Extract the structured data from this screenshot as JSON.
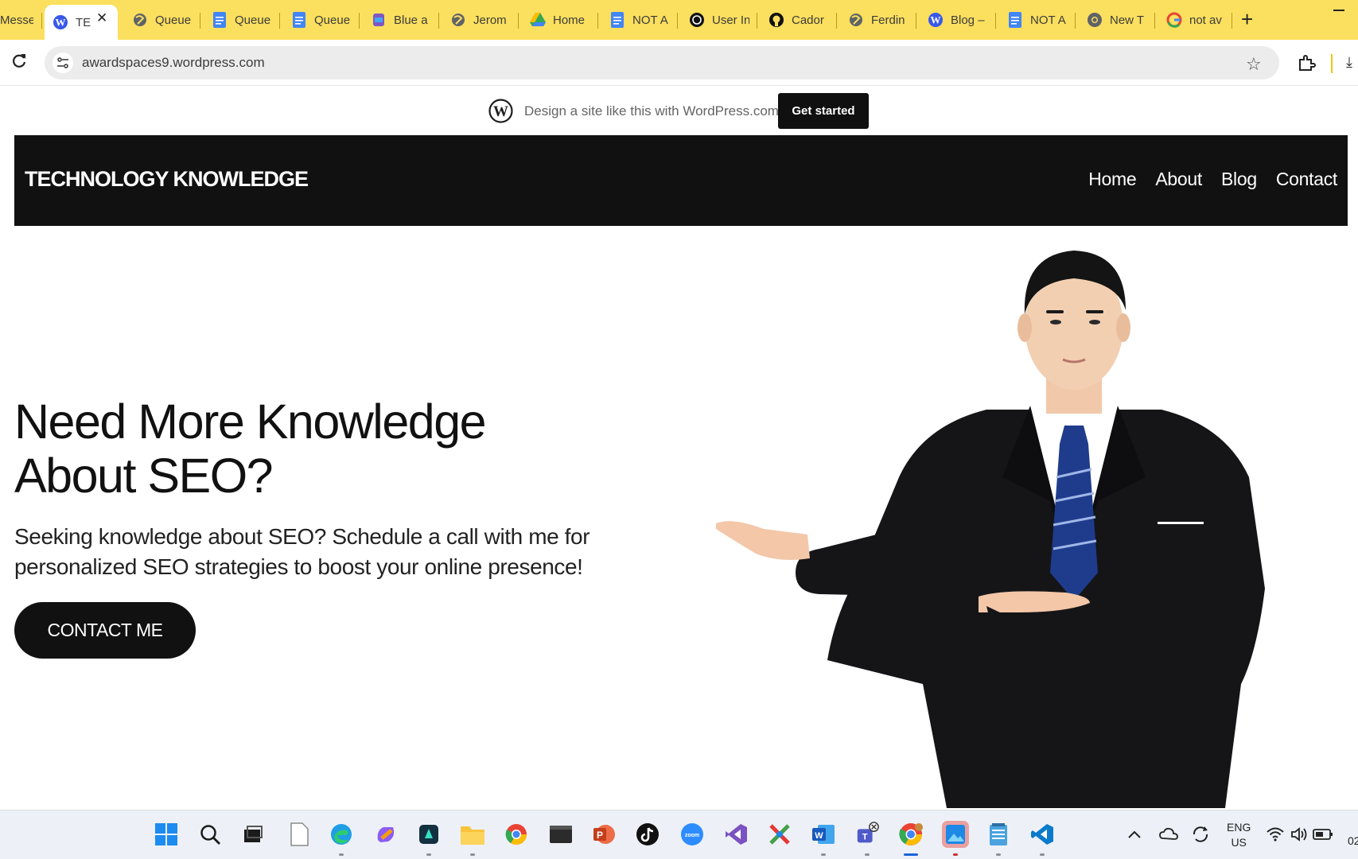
{
  "browser": {
    "tabs": [
      {
        "label": "Messe",
        "icon": "messenger-icon"
      },
      {
        "label": "TE",
        "icon": "wordpress-icon",
        "active": true
      },
      {
        "label": "Queue",
        "icon": "globe-icon"
      },
      {
        "label": "Queue",
        "icon": "docs-icon"
      },
      {
        "label": "Queue",
        "icon": "docs-icon"
      },
      {
        "label": "Blue a",
        "icon": "print-icon"
      },
      {
        "label": "Jerom",
        "icon": "globe-icon"
      },
      {
        "label": "Home",
        "icon": "drive-icon"
      },
      {
        "label": "NOT A",
        "icon": "docs-icon"
      },
      {
        "label": "User In",
        "icon": "openai-icon"
      },
      {
        "label": "Cador",
        "icon": "github-icon"
      },
      {
        "label": "Ferdin",
        "icon": "globe-icon"
      },
      {
        "label": "Blog –",
        "icon": "wordpress-icon"
      },
      {
        "label": "NOT A",
        "icon": "docs-icon"
      },
      {
        "label": "New T",
        "icon": "chrome-icon"
      },
      {
        "label": "not av",
        "icon": "google-icon"
      }
    ],
    "new_tab": "+",
    "url": "awardspaces9.wordpress.com"
  },
  "promo": {
    "text": "Design a site like this with WordPress.com",
    "button": "Get started"
  },
  "site": {
    "title": "TECHNOLOGY KNOWLEDGE",
    "nav": [
      "Home",
      "About",
      "Blog",
      "Contact"
    ],
    "hero_title_line1": "Need More Knowledge",
    "hero_title_line2": "About SEO?",
    "hero_sub_line1": "Seeking knowledge about SEO? Schedule a call with me for",
    "hero_sub_line2": "personalized SEO strategies to boost your online presence!",
    "cta": "CONTACT ME"
  },
  "taskbar": {
    "apps": [
      "start-icon",
      "search-icon",
      "task-view-icon",
      "file-icon",
      "edge-icon",
      "copilot-icon",
      "app-icon",
      "file-explorer-icon",
      "chrome-icon",
      "terminal-icon",
      "powerpoint-icon",
      "tiktok-icon",
      "zoom-icon",
      "visual-studio-icon",
      "snipping-icon",
      "word-icon",
      "teams-icon",
      "chrome-icon",
      "photos-icon",
      "notepad-icon",
      "vscode-icon"
    ],
    "lang_line1": "ENG",
    "lang_line2": "US",
    "clock": "02"
  }
}
